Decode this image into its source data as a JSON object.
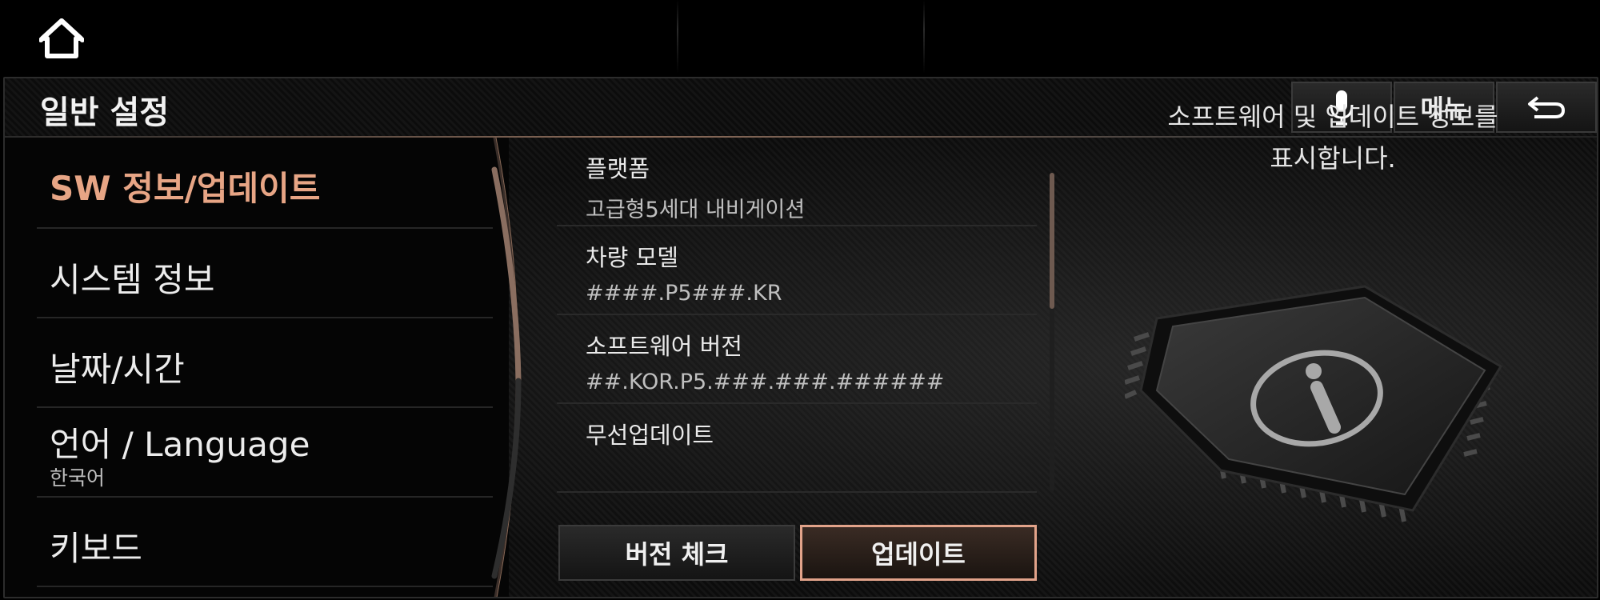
{
  "header": {
    "title": "일반 설정",
    "menu_label": "메뉴"
  },
  "sidebar": {
    "items": [
      {
        "label": "SW 정보/업데이트",
        "sub": ""
      },
      {
        "label": "시스템 정보",
        "sub": ""
      },
      {
        "label": "날짜/시간",
        "sub": ""
      },
      {
        "label": "언어 / Language",
        "sub": "한국어"
      },
      {
        "label": "키보드",
        "sub": ""
      }
    ]
  },
  "info": {
    "rows": [
      {
        "label": "플랫폼",
        "value": "고급형5세대 내비게이션"
      },
      {
        "label": "차량 모델",
        "value": "####.P5###.KR"
      },
      {
        "label": "소프트웨어 버전",
        "value": "##.KOR.P5.###.###.######"
      },
      {
        "label": "무선업데이트",
        "value": ""
      }
    ]
  },
  "buttons": {
    "version_check": "버전 체크",
    "update": "업데이트"
  },
  "description": {
    "line1": "소프트웨어 및 업데이트 정보를",
    "line2": "표시합니다."
  },
  "icons": {
    "home": "home-icon",
    "mic": "microphone-icon",
    "back": "back-arrow-icon",
    "info": "info-chip-icon"
  },
  "colors": {
    "accent": "#e7a585",
    "update_border": "#e2a38a"
  }
}
